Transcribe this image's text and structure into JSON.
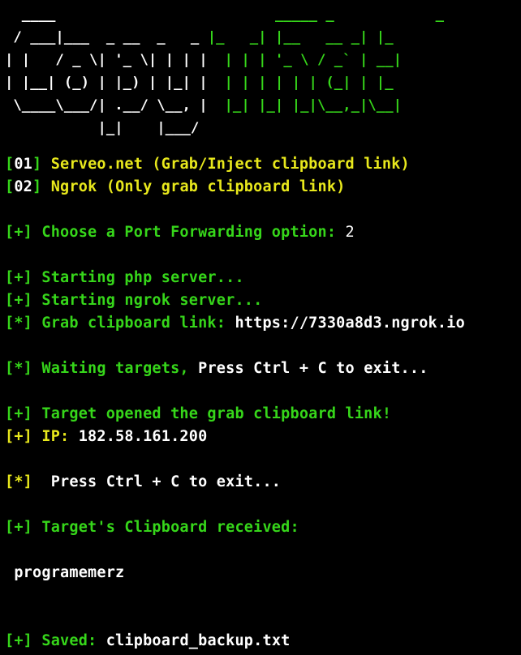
{
  "colors": {
    "background": "#000000",
    "green": "#36d61a",
    "yellow": "#e8e81c",
    "white": "#ffffff"
  },
  "banner": {
    "left_part": [
      "  ____",
      " / ___|___  _ __  _   _ ",
      "| |   / _ \\| '_ \\| | | |",
      "| |__| (_) | |_) | |_| |",
      " \\____\\___/| .__/ \\__, |",
      "           |_|    |___/ "
    ],
    "right_part": [
      "                _____ _            _   ",
      "|_   _| |__   __ _| |_ ",
      "  | | | '_ \\ / _` | __|",
      "  | | | | | | (_| | |_ ",
      "  |_| |_| |_|\\__,_|\\__|",
      ""
    ]
  },
  "menu": {
    "options": [
      {
        "bracket_open": "[",
        "num": "01",
        "bracket_close": "]",
        "label": " Serveo.net (Grab/Inject clipboard link)"
      },
      {
        "bracket_open": "[",
        "num": "02",
        "bracket_close": "]",
        "label": " Ngrok (Only grab clipboard link)"
      }
    ]
  },
  "prompt": {
    "prefix": "[+]",
    "text": " Choose a Port Forwarding option: ",
    "value": "2"
  },
  "status": {
    "php": {
      "prefix": "[+]",
      "text": " Starting php server..."
    },
    "ngrok": {
      "prefix": "[+]",
      "text": " Starting ngrok server..."
    },
    "grab": {
      "prefix": "[*]",
      "text": " Grab clipboard link: ",
      "value": "https://7330a8d3.ngrok.io"
    }
  },
  "waiting": {
    "prefix": "[*]",
    "text": " Waiting targets, ",
    "value": "Press Ctrl + C to exit..."
  },
  "target": {
    "opened": {
      "prefix": "[+]",
      "text": " Target opened the grab clipboard link!"
    },
    "ip": {
      "prefix": "[+]",
      "label": " IP: ",
      "value": "182.58.161.200"
    }
  },
  "exit_notice": {
    "prefix": "[*]",
    "text": "  Press Ctrl + C to exit..."
  },
  "clipboard": {
    "prefix": "[+]",
    "text": " Target's Clipboard received:",
    "content": " programemerz"
  },
  "saved": {
    "prefix": "[+]",
    "label": " Saved: ",
    "value": "clipboard_backup.txt"
  }
}
